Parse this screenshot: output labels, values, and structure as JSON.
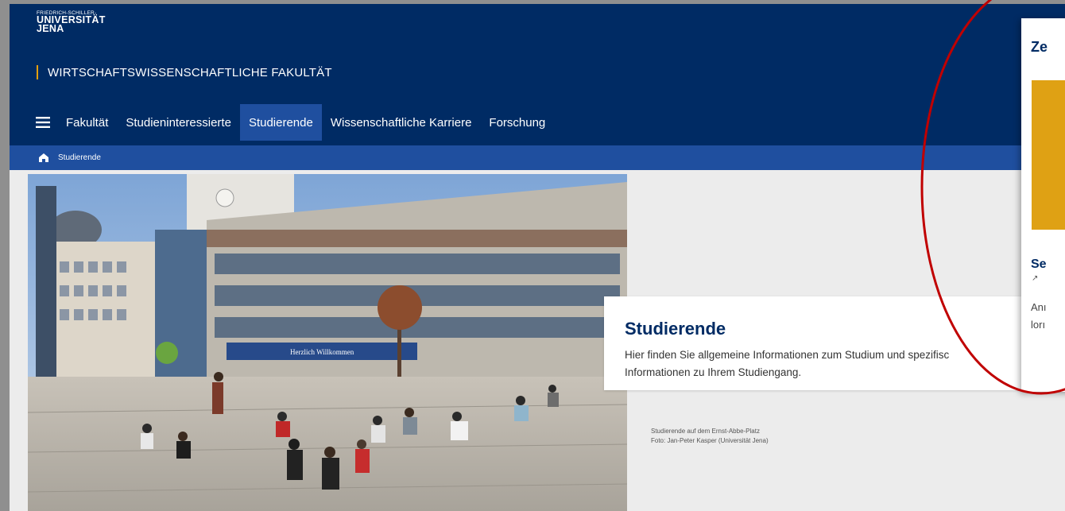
{
  "logo": {
    "line1": "FRIEDRICH-SCHILLER-",
    "line2": "UNIVERSITÄT",
    "line3": "JENA"
  },
  "faculty": "WIRTSCHAFTSWISSENSCHAFTLICHE FAKULTÄT",
  "nav": {
    "items": [
      {
        "label": "Fakultät"
      },
      {
        "label": "Studieninteressierte"
      },
      {
        "label": "Studierende",
        "active": true
      },
      {
        "label": "Wissenschaftliche Karriere"
      },
      {
        "label": "Forschung"
      }
    ]
  },
  "breadcrumb": {
    "current": "Studierende"
  },
  "intro": {
    "title": "Studierende",
    "text_line1": "Hier finden Sie allgemeine Informationen zum Studium und spezifisc",
    "text_line2": "Informationen zu Ihrem Studiengang."
  },
  "caption": {
    "line1": "Studierende auf dem Ernst-Abbe-Platz",
    "line2": "Foto: Jan-Peter Kasper (Universität Jena)"
  },
  "hero_image": {
    "banner_text": "Herzlich Willkommen"
  },
  "side_panel": {
    "title": "Ze",
    "subtitle": "Se",
    "arrow": "↗",
    "text_line1": "Anı",
    "text_line2": "lorı"
  },
  "colors": {
    "primary": "#002b64",
    "active_blue": "#1f4f9f",
    "accent_gold": "#dfa114",
    "highlight_red": "#c00000"
  }
}
